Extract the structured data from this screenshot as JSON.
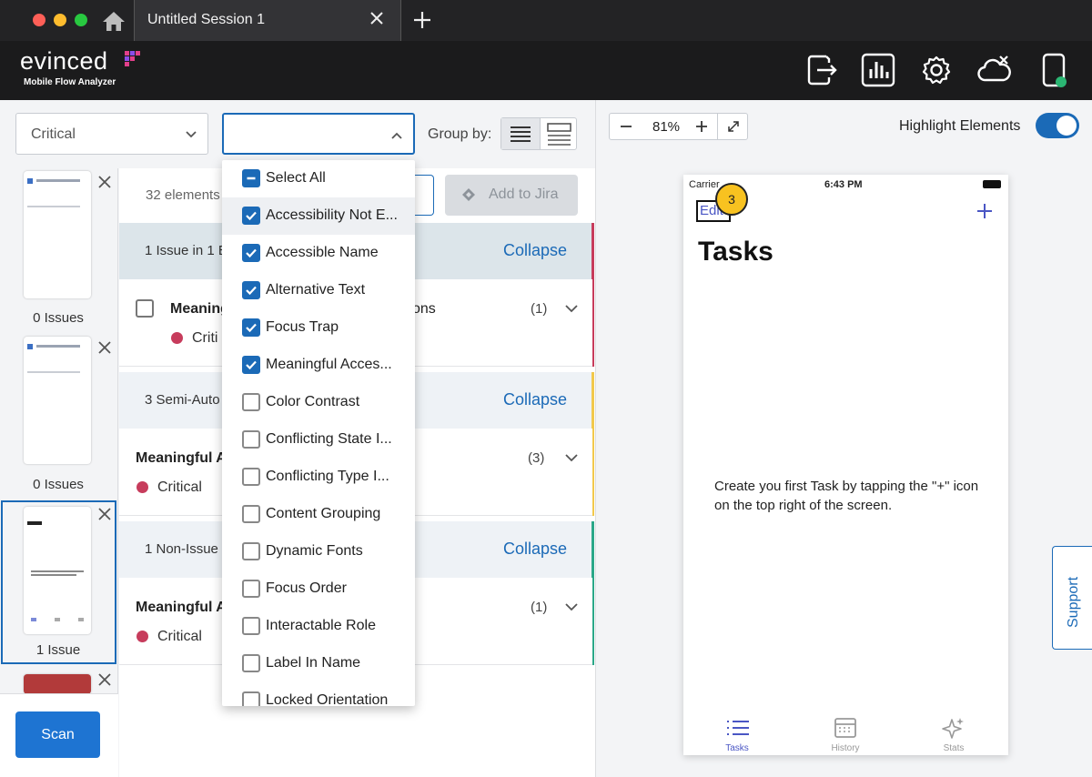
{
  "window": {
    "tab_title": "Untitled Session 1"
  },
  "header": {
    "brand": "evinced",
    "subtitle": "Mobile Flow Analyzer"
  },
  "filters": {
    "severity_value": "Critical",
    "type_value": "",
    "group_by_label": "Group by:"
  },
  "thumbnails": [
    {
      "label": "0 Issues"
    },
    {
      "label": "0 Issues"
    },
    {
      "label": "1 Issue"
    }
  ],
  "toolbar": {
    "element_count": "32 elements",
    "jira_label": "Add to Jira"
  },
  "groups": [
    {
      "label": "1 Issue in 1 El",
      "collapse": "Collapse",
      "color": "#c73c5c"
    },
    {
      "label": "3 Semi-Auto",
      "collapse": "Collapse",
      "color": "#f2c94c"
    },
    {
      "label": "1 Non-Issue",
      "collapse": "Collapse",
      "color": "#2ba889"
    }
  ],
  "issues": [
    {
      "title": "Meaning",
      "title_right": "ons",
      "count": "(1)",
      "severity": "Criti"
    },
    {
      "title": "Meaningful A",
      "count": "(3)",
      "severity": "Critical"
    },
    {
      "title": "Meaningful A",
      "count": "(1)",
      "severity": "Critical"
    }
  ],
  "dropdown": {
    "options": [
      {
        "label": "Select All",
        "state": "partial"
      },
      {
        "label": "Accessibility Not E...",
        "state": "checked"
      },
      {
        "label": "Accessible Name",
        "state": "checked"
      },
      {
        "label": "Alternative Text",
        "state": "checked"
      },
      {
        "label": "Focus Trap",
        "state": "checked"
      },
      {
        "label": "Meaningful Acces...",
        "state": "checked"
      },
      {
        "label": "Color Contrast",
        "state": "unchecked"
      },
      {
        "label": "Conflicting State I...",
        "state": "unchecked"
      },
      {
        "label": "Conflicting Type I...",
        "state": "unchecked"
      },
      {
        "label": "Content Grouping",
        "state": "unchecked"
      },
      {
        "label": "Dynamic Fonts",
        "state": "unchecked"
      },
      {
        "label": "Focus Order",
        "state": "unchecked"
      },
      {
        "label": "Interactable Role",
        "state": "unchecked"
      },
      {
        "label": "Label In Name",
        "state": "unchecked"
      },
      {
        "label": "Locked Orientation",
        "state": "unchecked"
      }
    ]
  },
  "preview": {
    "zoom": "81%",
    "highlight_label": "Highlight Elements",
    "highlight_on": true
  },
  "phone": {
    "carrier": "Carrier",
    "time": "6:43 PM",
    "edit": "Edit",
    "badge": "3",
    "title": "Tasks",
    "empty_message": "Create you first Task by tapping the \"+\" icon on the top right of the screen.",
    "tabs": [
      {
        "label": "Tasks",
        "icon": "list-icon",
        "active": true
      },
      {
        "label": "History",
        "icon": "calendar-icon",
        "active": false
      },
      {
        "label": "Stats",
        "icon": "sparkle-icon",
        "active": false
      }
    ]
  },
  "support": {
    "label": "Support"
  },
  "scan": {
    "label": "Scan"
  },
  "colors": {
    "accent": "#1b6ab7",
    "critical": "#c73c5c",
    "badge": "#f8c220"
  }
}
